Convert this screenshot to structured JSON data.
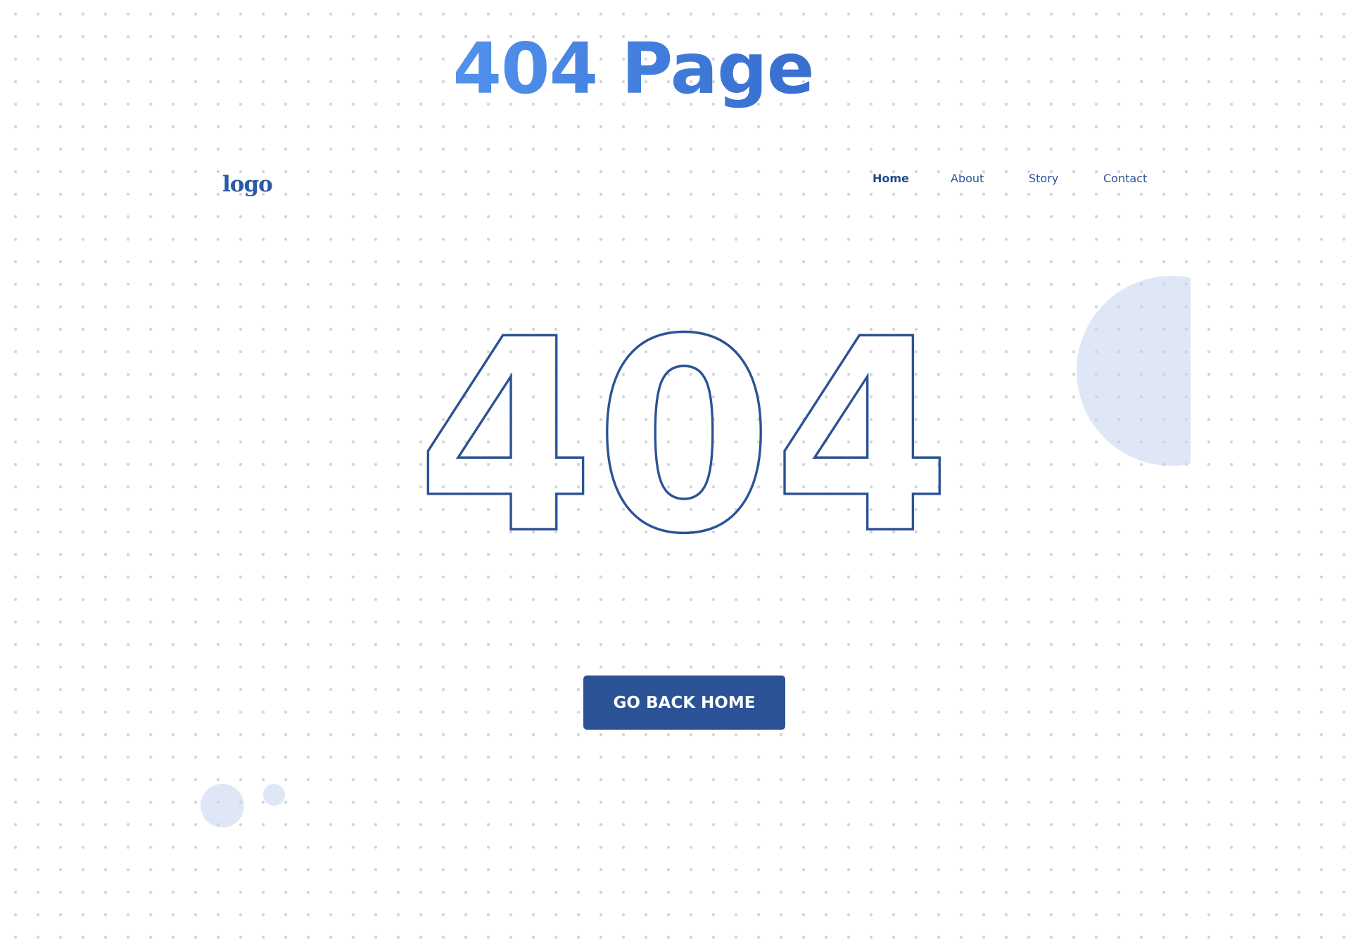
{
  "page": {
    "heading": "404 Page"
  },
  "header": {
    "logo": "logo",
    "nav": [
      {
        "label": "Home",
        "active": true
      },
      {
        "label": "About",
        "active": false
      },
      {
        "label": "Story",
        "active": false
      },
      {
        "label": "Contact",
        "active": false
      }
    ]
  },
  "main": {
    "error_code": "404",
    "button_label": "GO BACK HOME"
  },
  "colors": {
    "brand_blue": "#2b5296",
    "heading_blue": "#3a78d6",
    "decor_light_blue": "#c4d4f0",
    "background_dots": "#d3d6db"
  }
}
